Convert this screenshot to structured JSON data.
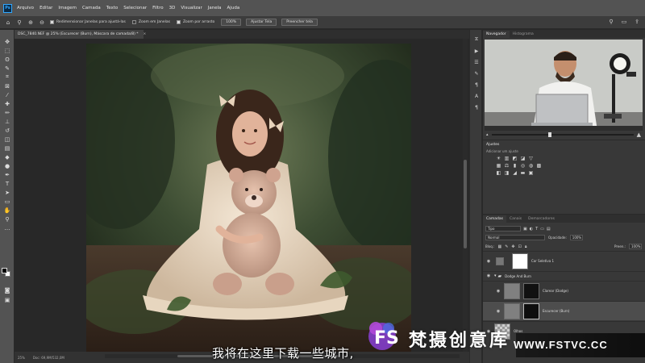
{
  "menu": {
    "items": [
      "Arquivo",
      "Editar",
      "Imagem",
      "Camada",
      "Texto",
      "Selecionar",
      "Filtro",
      "3D",
      "Visualizar",
      "Janela",
      "Ajuda"
    ]
  },
  "options_bar": {
    "resize_windows_label": "Redimensionar Janelas para ajustá-las",
    "zoom_all_windows_label": "Zoom em Janelas",
    "scrubby_zoom_label": "Zoom por arrasto",
    "zoom_percent": "100%",
    "fit_screen_label": "Ajustar Tela",
    "fill_screen_label": "Preencher tela"
  },
  "document": {
    "tab_title": "DSC_7840.NEF @ 25% (Escurecer (Burn), Máscara de camada/8) *",
    "status_zoom": "25%",
    "status_doc": "Doc: 69,9M/532,0M"
  },
  "navigator": {
    "tab_navigator": "Navegador",
    "tab_histogram": "Histograma"
  },
  "adjustments": {
    "title": "Ajustes",
    "subtitle": "Adicionar um ajuste"
  },
  "layers_panel": {
    "tab_layers": "Camadas",
    "tab_channels": "Canais",
    "tab_paths": "Demarcadores",
    "filter_kind": "Tipo",
    "blend_mode": "Normal",
    "opacity_label": "Opacidade:",
    "opacity_value": "100%",
    "lock_label": "Bloq.:",
    "fill_label": "Preen.:",
    "layers": [
      {
        "name": "Cor Seletiva 1"
      },
      {
        "name": "Dodge And Burn"
      },
      {
        "name": "Clarear (Dodge)"
      },
      {
        "name": "Escurecer (Burn)"
      },
      {
        "name": "Olhos"
      }
    ]
  },
  "subtitle_text": "我将在这里下载一些城市,",
  "watermark": {
    "brand": "梵摄创意库",
    "url": "WWW.FSTVC.CC"
  },
  "colors": {
    "accent": "#31a8ff",
    "menu_bg": "#535353",
    "panel_bg": "#383838"
  }
}
